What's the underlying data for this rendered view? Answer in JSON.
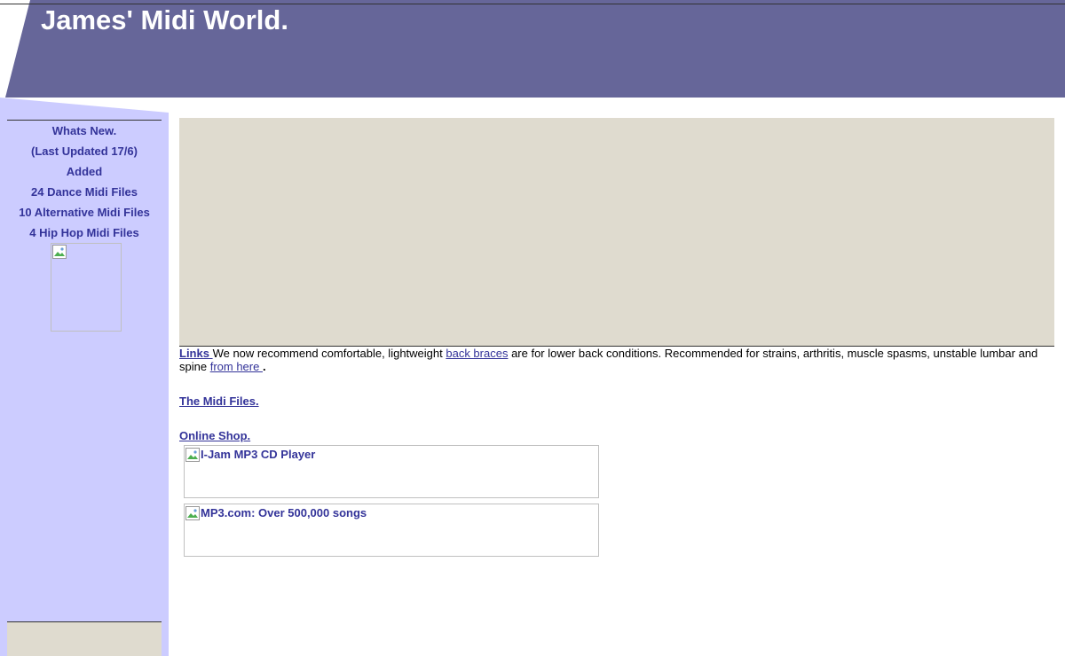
{
  "header": {
    "title": "James' Midi World."
  },
  "sidebar": {
    "items": [
      "Whats New.",
      "(Last Updated 17/6)",
      "Added",
      "24 Dance Midi Files",
      "10 Alternative Midi Files",
      "4 Hip Hop Midi Files"
    ],
    "image_icon": "broken-image-icon"
  },
  "main": {
    "links_label": "Links ",
    "text_before": "We now recommend comfortable, lightweight ",
    "back_braces_link": "back braces",
    "text_middle": " are for lower back conditions. Recommended for strains, arthritis, muscle spasms, unstable lumbar and spine ",
    "from_here_link": "from here ",
    "text_end": ".",
    "midi_files_link": "The Midi Files.",
    "online_shop_link": "Online Shop.",
    "shop_items": [
      "I-Jam MP3 CD Player",
      "MP3.com: Over 500,000 songs"
    ]
  },
  "colors": {
    "header": "#666699",
    "sidebar": "#ccccff",
    "link": "#333399",
    "panel": "#dfdbcf"
  }
}
